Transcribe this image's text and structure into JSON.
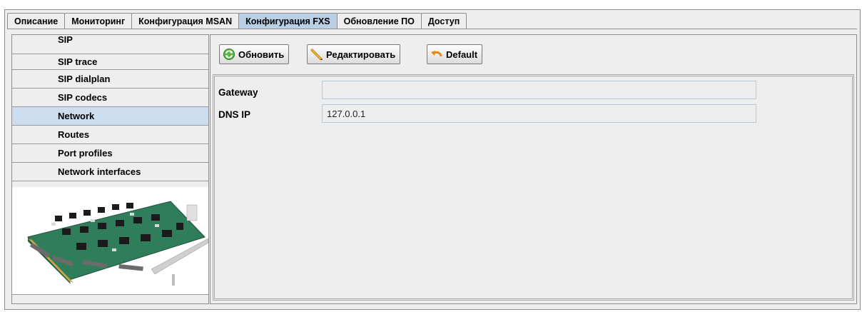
{
  "tabs": [
    {
      "label": "Описание",
      "active": false
    },
    {
      "label": "Мониторинг",
      "active": false
    },
    {
      "label": "Конфигурация MSAN",
      "active": false
    },
    {
      "label": "Конфигурация FXS",
      "active": true
    },
    {
      "label": "Обновление ПО",
      "active": false
    },
    {
      "label": "Доступ",
      "active": false
    }
  ],
  "sidebar": {
    "items": [
      {
        "label": "SIP"
      },
      {
        "label": "SIP trace"
      },
      {
        "label": "SIP dialplan"
      },
      {
        "label": "SIP codecs"
      },
      {
        "label": "Network",
        "active": true
      },
      {
        "label": "Routes"
      },
      {
        "label": "Port profiles"
      },
      {
        "label": "Network interfaces"
      }
    ]
  },
  "toolbar": {
    "refresh_label": "Обновить",
    "edit_label": "Редактировать",
    "default_label": "Default"
  },
  "form": {
    "gateway_label": "Gateway",
    "gateway_value": "",
    "dns_label": "DNS IP",
    "dns_value": "127.0.0.1"
  },
  "colors": {
    "active_tab": "#b8cfe5",
    "active_nav": "#ccddf0",
    "panel_bg": "#eeeeee"
  }
}
